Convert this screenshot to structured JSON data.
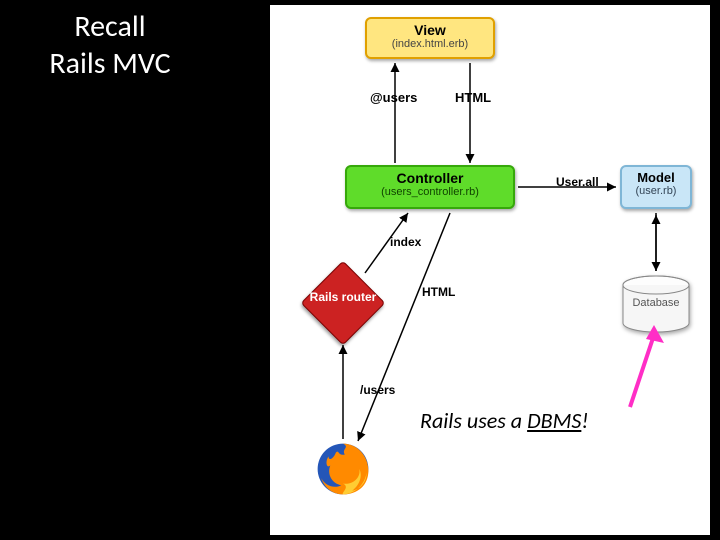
{
  "title": {
    "line1": "Recall",
    "line2": "Rails MVC"
  },
  "view": {
    "name": "View",
    "file": "(index.html.erb)"
  },
  "controller": {
    "name": "Controller",
    "file": "(users_controller.rb)"
  },
  "model": {
    "name": "Model",
    "file": "(user.rb)"
  },
  "router": {
    "name": "Rails router"
  },
  "database": {
    "label": "Database"
  },
  "labels": {
    "at_users": "@users",
    "html": "HTML",
    "user_all": "User.all",
    "index": "index",
    "slash_users": "/users"
  },
  "callout": {
    "prefix": "Rails uses a ",
    "emph": "DBMS",
    "suffix": "!"
  },
  "colors": {
    "view_fill": "#ffe680",
    "controller_fill": "#5fdc2a",
    "model_fill": "#c9e6f7",
    "router_fill": "#cc2222",
    "pink_arrow": "#ff2ec6"
  }
}
